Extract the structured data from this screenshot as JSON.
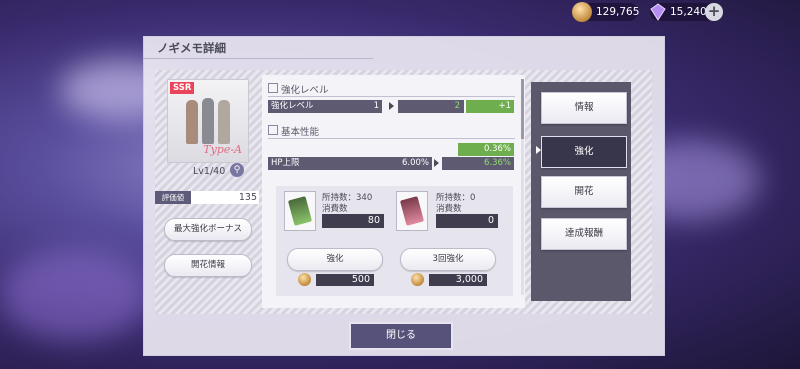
{
  "resources": {
    "coins": "129,765",
    "gems": "15,240"
  },
  "dialog": {
    "title": "ノギメモ詳細",
    "close_label": "閉じる"
  },
  "card": {
    "rarity": "SSR",
    "type_label": "Type-A",
    "level": "Lv1/40",
    "eval_label": "評価値",
    "eval_value": "135"
  },
  "left_buttons": {
    "max_bonus": "最大強化ボーナス",
    "bloom_info": "開花情報"
  },
  "enhance_level": {
    "section": "強化レベル",
    "label": "強化レベル",
    "current": "1",
    "next": "2",
    "delta": "+1"
  },
  "basic": {
    "section": "基本性能",
    "delta": "0.36%",
    "label": "HP上限",
    "current": "6.00%",
    "next": "6.36%"
  },
  "materials": [
    {
      "owned": "所持数：340",
      "use_label": "消費数",
      "use": "80"
    },
    {
      "owned": "所持数：0",
      "use_label": "消費数",
      "use": "0"
    }
  ],
  "actions": [
    {
      "label": "強化",
      "cost": "500"
    },
    {
      "label": "3回強化",
      "cost": "3,000"
    }
  ],
  "tabs": [
    "情報",
    "強化",
    "開花",
    "達成報酬"
  ],
  "colors": {
    "accent_green": "#6fae4e",
    "dark_panel": "#5b586c",
    "rarity_red": "#e8455a"
  }
}
